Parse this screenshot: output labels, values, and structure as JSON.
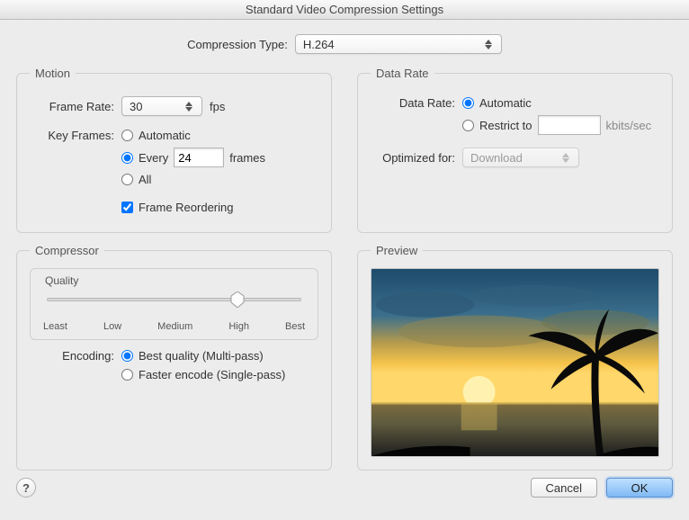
{
  "window": {
    "title": "Standard Video Compression Settings"
  },
  "compression": {
    "label": "Compression Type:",
    "value": "H.264"
  },
  "motion": {
    "legend": "Motion",
    "frame_rate": {
      "label": "Frame Rate:",
      "value": "30",
      "unit": "fps"
    },
    "key_frames": {
      "label": "Key Frames:",
      "automatic": "Automatic",
      "every": "Every",
      "every_value": "24",
      "every_unit": "frames",
      "all": "All",
      "selected": "every"
    },
    "frame_reordering": {
      "label": "Frame Reordering",
      "checked": true
    }
  },
  "data_rate": {
    "legend": "Data Rate",
    "label": "Data Rate:",
    "automatic": "Automatic",
    "restrict": "Restrict to",
    "restrict_value": "",
    "restrict_unit": "kbits/sec",
    "selected": "automatic",
    "optimized_label": "Optimized for:",
    "optimized_value": "Download"
  },
  "compressor": {
    "legend": "Compressor",
    "quality": {
      "label": "Quality",
      "ticks": [
        "Least",
        "Low",
        "Medium",
        "High",
        "Best"
      ],
      "value_index": 3
    },
    "encoding": {
      "label": "Encoding:",
      "best": "Best quality (Multi-pass)",
      "faster": "Faster encode (Single-pass)",
      "selected": "best"
    }
  },
  "preview": {
    "legend": "Preview"
  },
  "footer": {
    "help": "?",
    "cancel": "Cancel",
    "ok": "OK"
  }
}
